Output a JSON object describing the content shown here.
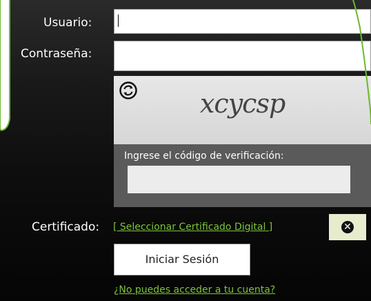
{
  "form": {
    "username_label": "Usuario:",
    "username_value": "",
    "password_label": "Contraseña:",
    "password_value": ""
  },
  "captcha": {
    "text": "xcycsp",
    "refresh_icon": "refresh-icon",
    "verify_label": "Ingrese el código de verificación:",
    "verify_value": ""
  },
  "certificate": {
    "label": "Certificado:",
    "link": "[ Seleccionar Certificado Digital ]",
    "clear_icon": "close-circle-icon"
  },
  "actions": {
    "login_label": "Iniciar Sesión",
    "forgot_link": "¿No puedes acceder a tu cuenta?"
  },
  "colors": {
    "link": "#7cc43a",
    "annotation_green": "#6bb82b",
    "panel_bg": "#111111"
  }
}
